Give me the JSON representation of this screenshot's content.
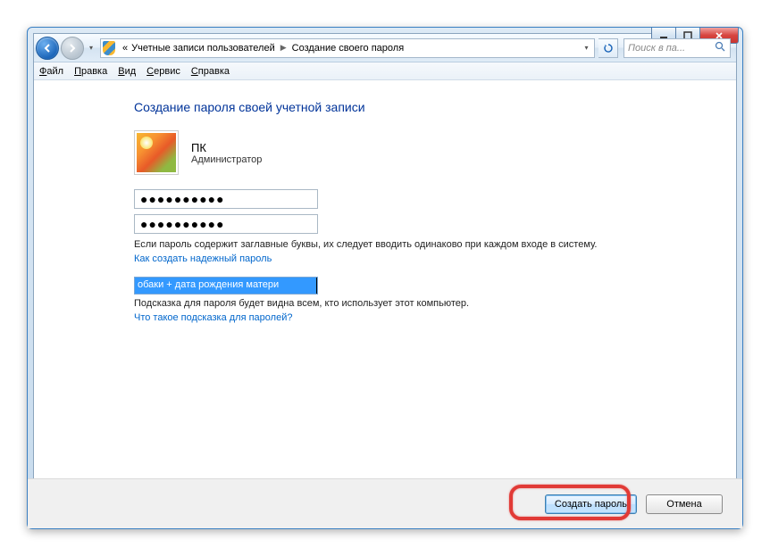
{
  "breadcrumb": {
    "prefix": "«",
    "parent": "Учетные записи пользователей",
    "current": "Создание своего пароля"
  },
  "search": {
    "placeholder": "Поиск в па..."
  },
  "menu": {
    "file": "Файл",
    "edit": "Правка",
    "view": "Вид",
    "tools": "Сервис",
    "help": "Справка"
  },
  "page": {
    "title": "Создание пароля своей учетной записи",
    "user_name": "ПК",
    "user_role": "Администратор",
    "password1": "●●●●●●●●●●",
    "password2": "●●●●●●●●●●",
    "caps_note": "Если пароль содержит заглавные буквы, их следует вводить одинаково при каждом входе в систему.",
    "strong_link": "Как создать надежный пароль",
    "hint_value": "обаки + дата рождения матери",
    "hint_note": "Подсказка для пароля будет видна всем, кто использует этот компьютер.",
    "hint_link": "Что такое подсказка для паролей?"
  },
  "buttons": {
    "create": "Создать пароль",
    "cancel": "Отмена"
  }
}
